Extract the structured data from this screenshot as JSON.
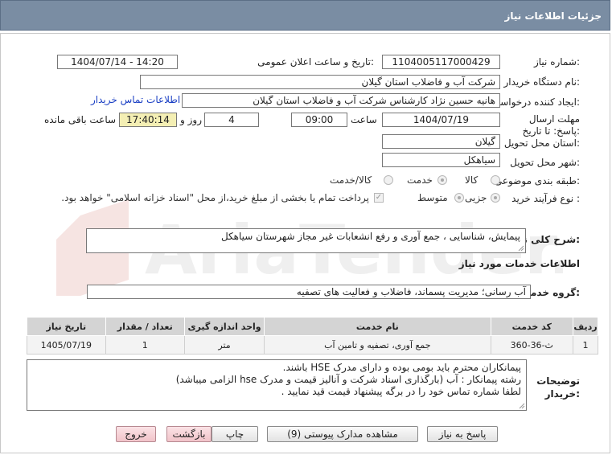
{
  "header": {
    "title": "جزئیات اطلاعات نیاز"
  },
  "fields": {
    "need_number_label": "شماره نیاز:",
    "need_number": "1104005117000429",
    "announce_label": "تاریخ و ساعت اعلان عمومی:",
    "announce_value": "1404/07/14 - 14:20",
    "buyer_org_label": "نام دستگاه خریدار:",
    "buyer_org": "شرکت آب و فاضلاب استان گیلان",
    "creator_label": "ایجاد کننده درخواست:",
    "creator": "هانیه حسین نژاد کارشناس شرکت آب و فاضلاب استان گیلان",
    "contact_link": "اطلاعات تماس خریدار",
    "deadline_label": "مهلت ارسال پاسخ: تا تاریخ:",
    "deadline_date": "1404/07/19",
    "time_label": "ساعت",
    "deadline_time": "09:00",
    "days": "4",
    "days_label": "روز و",
    "remaining_time": "17:40:14",
    "remaining_label": "ساعت باقی مانده",
    "province_label": "استان محل تحویل:",
    "province": "گیلان",
    "city_label": "شهر محل تحویل:",
    "city": "سیاهکل",
    "category_label": "طبقه بندی موضوعی:",
    "category_options": [
      "کالا",
      "خدمت",
      "کالا/خدمت"
    ],
    "category_selected": "خدمت",
    "process_label": "نوع فرآیند خرید :",
    "process_options": [
      "جزیی",
      "متوسط"
    ],
    "process_selected": "جزیی",
    "payment_note": "پرداخت تمام یا بخشی از مبلغ خرید،از محل \"اسناد خزانه اسلامی\" خواهد بود."
  },
  "summary": {
    "label": "شرح کلی نیاز:",
    "text": "پیمایش، شناسایی ، جمع آوری و رفع انشعابات غیر مجاز شهرستان سیاهکل"
  },
  "services": {
    "section_title": "اطلاعات خدمات مورد نیاز",
    "group_label": "گروه خدمت:",
    "group_value": "آب رسانی؛ مدیریت پسماند، فاضلاب و فعالیت های تصفیه",
    "table": {
      "headers": [
        "ردیف",
        "کد خدمت",
        "نام خدمت",
        "واحد اندازه گیری",
        "تعداد / مقدار",
        "تاریخ نیاز"
      ],
      "rows": [
        [
          "1",
          "ث-36-360",
          "جمع آوری، تصفیه و تامین آب",
          "متر",
          "1",
          "1405/07/19"
        ]
      ]
    }
  },
  "notes": {
    "label": "توضیحات خریدار:",
    "lines": [
      "پیمانکاران محترم باید بومی بوده و  دارای مدرک HSE باشند.",
      "رشته پیمانکار :    آب   (بارگذاری اسناد شرکت و آنالیز قیمت و مدرک hse الزامی میباشد)",
      "لطفا شماره تماس خود را در برگه پیشنهاد قیمت قید نمایید ."
    ]
  },
  "buttons": {
    "reply": "پاسخ به نیاز",
    "docs": "مشاهده مدارک پیوستی (9)",
    "print": "چاپ",
    "back": "بازگشت",
    "exit": "خروج"
  },
  "watermark": {
    "text": "AriaTender.net"
  }
}
